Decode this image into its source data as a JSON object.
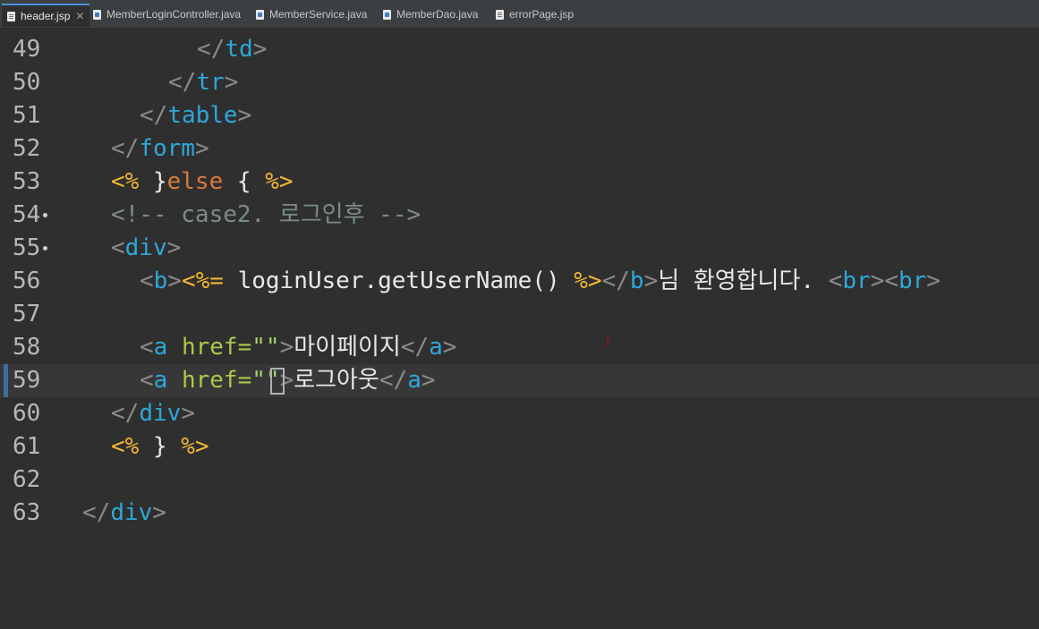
{
  "tabs": [
    {
      "label": "header.jsp",
      "type": "jsp",
      "active": true
    },
    {
      "label": "MemberLoginController.java",
      "type": "java"
    },
    {
      "label": "MemberService.java",
      "type": "java"
    },
    {
      "label": "MemberDao.java",
      "type": "java"
    },
    {
      "label": "errorPage.jsp",
      "type": "jsp"
    }
  ],
  "tab_close_glyph": "✕",
  "lines": [
    {
      "num": "49"
    },
    {
      "num": "50"
    },
    {
      "num": "51"
    },
    {
      "num": "52"
    },
    {
      "num": "53"
    },
    {
      "num": "54"
    },
    {
      "num": "55"
    },
    {
      "num": "56"
    },
    {
      "num": "57"
    },
    {
      "num": "58"
    },
    {
      "num": "59"
    },
    {
      "num": "60"
    },
    {
      "num": "61"
    },
    {
      "num": "62"
    },
    {
      "num": "63"
    }
  ],
  "code": {
    "td": "td",
    "tr": "tr",
    "table": "table",
    "form": "form",
    "jsp_open": "<%",
    "jsp_close": "%>",
    "jsp_expr_open": "<%=",
    "else_kw": "else",
    "brace_close": "}",
    "brace_open": "{",
    "comment": "<!-- case2. 로그인후 -->",
    "div": "div",
    "b": "b",
    "br": "br",
    "expr": "loginUser.getUserName()",
    "welcome": "님 환영합니다. ",
    "a": "a",
    "href": "href=",
    "quote": "\"\"",
    "q1": "\"",
    "q2": "\"",
    "mypage": "마이페이지",
    "logout": "로그아웃"
  },
  "colors": {
    "background": "#2f2f2f",
    "tag": "#2ea7d9",
    "jsp_delim": "#f2b632",
    "keyword": "#d97a3a",
    "comment": "#7c8b8c",
    "string": "#a6d16e"
  },
  "mouse_cursor_icon": "I"
}
